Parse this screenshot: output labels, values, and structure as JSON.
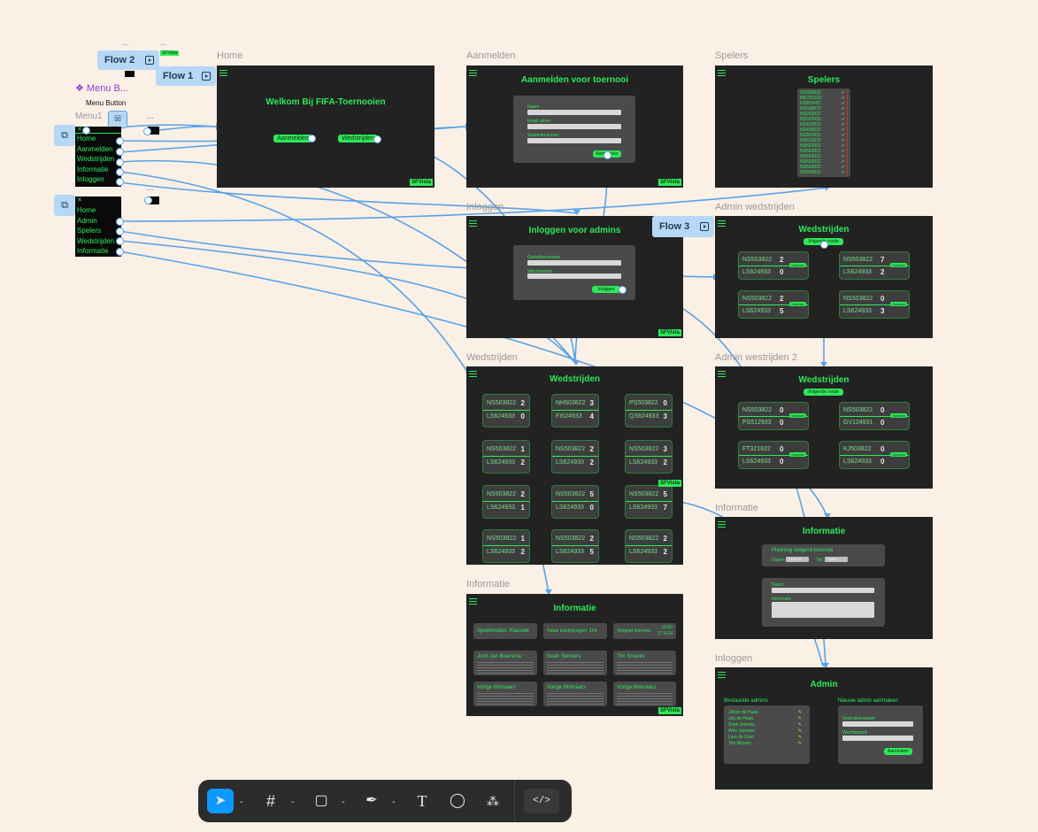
{
  "canvas": {
    "background": "#faf0e6",
    "accent": "#2ee85a",
    "frame_bg": "#222222",
    "connector": "#5aa2e6"
  },
  "labels": {
    "home": "Home",
    "aanmelden": "Aanmelden",
    "spelers": "Spelers",
    "inloggen": "Inloggen",
    "admin_wedstrijden": "Admin wedstrijden",
    "wedstrijden": "Wedstrijden",
    "admin_wedstrijden_2": "Admin westrijden 2",
    "informatie": "Informatie",
    "informatie_2": "Informatie",
    "inloggen_2": "Inloggen",
    "menu_component": "❖ Menu B...",
    "menu_button": "Menu Button",
    "menu1": "Menu1",
    "dots": "..."
  },
  "flows": {
    "flow1": "Flow 1",
    "flow2": "Flow 2",
    "flow3": "Flow 3"
  },
  "menu1": [
    "Home",
    "Aanmelden",
    "Wedstrijden",
    "Informatie",
    "Inloggen"
  ],
  "menu2": [
    "Home",
    "Admin",
    "Spelers",
    "Wedstrijden",
    "Informatie"
  ],
  "logo": "SFVista",
  "home": {
    "title": "Welkom Bij FIFA-Toernooien",
    "btn1": "Aanmelden",
    "btn2": "Wedstrijden"
  },
  "aanmelden": {
    "title": "Aanmelden voor toernooi",
    "f1": "Naam",
    "f2": "Email adres",
    "f3": "Studentnummer",
    "btn": "Aanmelden"
  },
  "spelers": {
    "title": "Spelers",
    "list": [
      "NS503822",
      "MS783333",
      "FS665432",
      "NS508872",
      "NS202837",
      "NS503432",
      "NS413822",
      "NS405822",
      "NS342822",
      "NS613822",
      "NS563822",
      "NS563822",
      "NS563822",
      "NS563822",
      "NS503822",
      "NS503822"
    ]
  },
  "inloggen": {
    "title": "Inloggen voor admins",
    "f1": "Gebruikersnaam",
    "f2": "Wachtwoord",
    "btn": "Inloggen"
  },
  "admin_w": {
    "title": "Wedstrijden",
    "btn": "Volgende ronde",
    "tag": "Opslaan",
    "matches": [
      {
        "a": "NS503822",
        "sa": "2",
        "b": "LS624933",
        "sb": "0"
      },
      {
        "a": "NS503822",
        "sa": "7",
        "b": "LS624933",
        "sb": "2"
      },
      {
        "a": "NS503822",
        "sa": "2",
        "b": "LS624933",
        "sb": "5"
      },
      {
        "a": "NS503822",
        "sa": "0",
        "b": "LS624933",
        "sb": "3"
      }
    ]
  },
  "admin_w2": {
    "title": "Wedstrijden",
    "btn": "Volgende ronde",
    "tag": "Opslaan",
    "matches": [
      {
        "a": "NS503822",
        "sa": "0",
        "b": "PS512933",
        "sb": "0"
      },
      {
        "a": "NS503822",
        "sa": "0",
        "b": "GV124931",
        "sb": "0"
      },
      {
        "a": "FT321822",
        "sa": "0",
        "b": "LS624933",
        "sb": "0"
      },
      {
        "a": "KJ503822",
        "sa": "0",
        "b": "LS624933",
        "sb": "0"
      }
    ]
  },
  "wedstrijden": {
    "title": "Wedstrijden",
    "matches": [
      {
        "a": "NS503822",
        "sa": "2",
        "b": "LS624933",
        "sb": "0"
      },
      {
        "a": "NH503822",
        "sa": "3",
        "b": "FI624933",
        "sb": "4"
      },
      {
        "a": "PS503822",
        "sa": "0",
        "b": "QS624933",
        "sb": "3"
      },
      {
        "a": "NS503822",
        "sa": "1",
        "b": "LS624933",
        "sb": "2"
      },
      {
        "a": "NS503822",
        "sa": "2",
        "b": "LS624933",
        "sb": "2"
      },
      {
        "a": "NS503822",
        "sa": "3",
        "b": "LS624933",
        "sb": "2"
      },
      {
        "a": "NS503822",
        "sa": "2",
        "b": "LS624933",
        "sb": "1"
      },
      {
        "a": "NS503822",
        "sa": "5",
        "b": "LS624933",
        "sb": "0"
      },
      {
        "a": "NS503822",
        "sa": "5",
        "b": "LS624933",
        "sb": "7"
      },
      {
        "a": "NS503822",
        "sa": "1",
        "b": "LS624933",
        "sb": "2"
      },
      {
        "a": "NS503822",
        "sa": "2",
        "b": "LS624933",
        "sb": "5"
      },
      {
        "a": "NS503822",
        "sa": "2",
        "b": "LS624933",
        "sb": "2"
      }
    ]
  },
  "informatie": {
    "title": "Informatie",
    "speelmodus": "Speelmodus: Klassiek",
    "totaal": "Totale inschrijvingen: 104",
    "volgend": "Volgend toernooi:",
    "volgend_time": "13:00",
    "volgend_date": "17-9-24",
    "boxes": [
      "Josh Jan Boersma",
      "Noah Siemers",
      "Tim Snoeks",
      "Vorige Winnaars",
      "Vorige Winnaars",
      "Vorige Winnaars"
    ]
  },
  "informatie_admin": {
    "title": "Informatie",
    "planning": "Planning volgend toernooi",
    "datum_l": "Datum",
    "datum_v": "17-9-24",
    "tijd_l": "Tijd",
    "tijd_v": "13:00",
    "naam": "Naam",
    "info": "Informatie"
  },
  "admin": {
    "title": "Admin",
    "bestaande": "Bestaande admins",
    "nieuw": "Nieuwe admin aanmaken",
    "admins": [
      "Johan de Haas",
      "Jan de Haas",
      "Sven Smeets",
      "Wim Janssen",
      "Lars de Geer",
      "Tim Rijssen"
    ],
    "f1": "Gebruikersnaam",
    "f2": "Wachtwoord",
    "btn": "Aanmaken"
  }
}
